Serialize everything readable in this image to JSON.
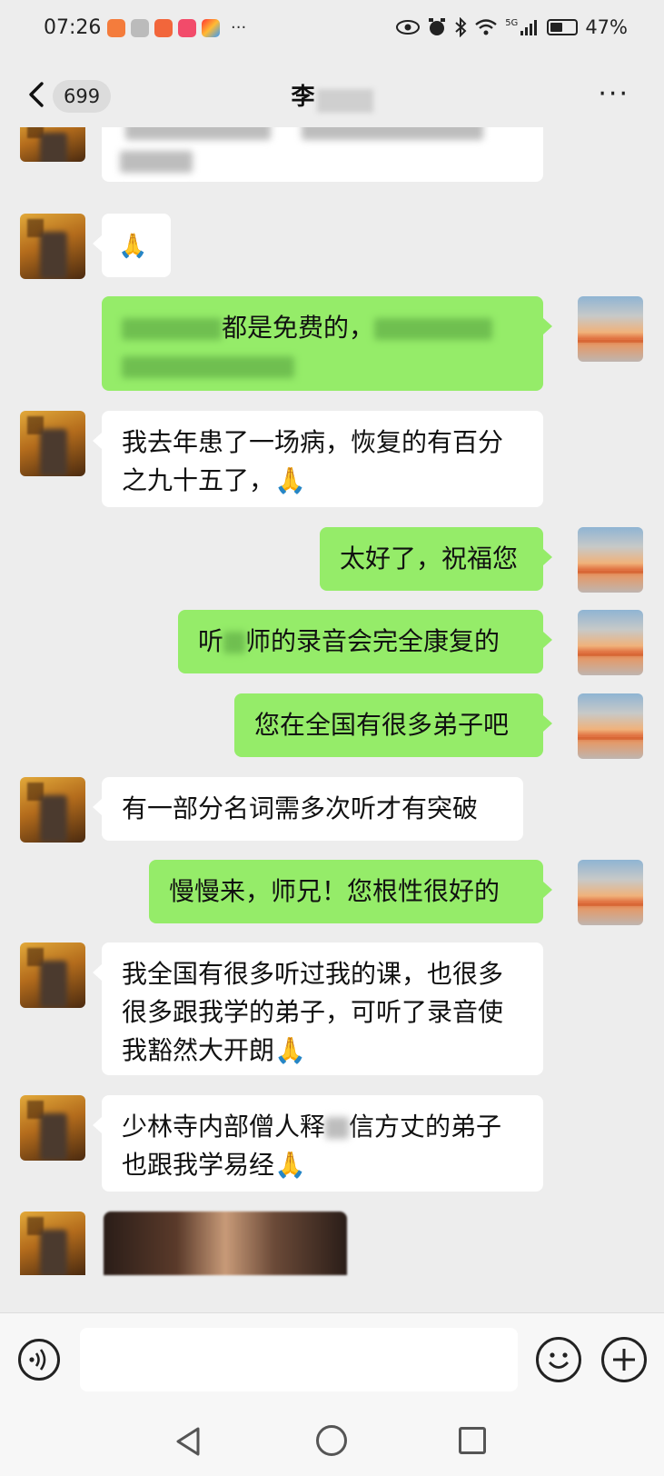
{
  "status_bar": {
    "time": "07:26",
    "more": "···",
    "signal_label": "5G",
    "battery": "47%",
    "battery_level": 0.47,
    "icons": [
      "eye-icon",
      "alarm-icon",
      "bluetooth-icon",
      "wifi-icon",
      "signal-icon",
      "battery-icon"
    ]
  },
  "header": {
    "unread_count": "699",
    "title": "李",
    "more": "···"
  },
  "messages": [
    {
      "side": "left",
      "text": ""
    },
    {
      "side": "left",
      "text": "🙏"
    },
    {
      "side": "right",
      "text_visible": "都是免费的，"
    },
    {
      "side": "left",
      "text": "我去年患了一场病，恢复的有百分之九十五了，🙏"
    },
    {
      "side": "right",
      "text": "太好了，祝福您"
    },
    {
      "side": "right",
      "text_before": "听",
      "text_after": "师的录音会完全康复的"
    },
    {
      "side": "right",
      "text": "您在全国有很多弟子吧"
    },
    {
      "side": "left",
      "text": "有一部分名词需多次听才有突破"
    },
    {
      "side": "right",
      "text": "慢慢来，师兄！您根性很好的"
    },
    {
      "side": "left",
      "text": "我全国有很多听过我的课，也很多很多跟我学的弟子，可听了录音使我豁然大开朗🙏"
    },
    {
      "side": "left",
      "text_before": "少林寺内部僧人释",
      "text_after": "信方丈的弟子也跟我学易经🙏"
    },
    {
      "side": "left",
      "type": "image"
    }
  ],
  "input_bar": {
    "placeholder": ""
  },
  "colors": {
    "background": "#ededed",
    "bubble_green": "#95ec69",
    "bubble_white": "#ffffff"
  }
}
